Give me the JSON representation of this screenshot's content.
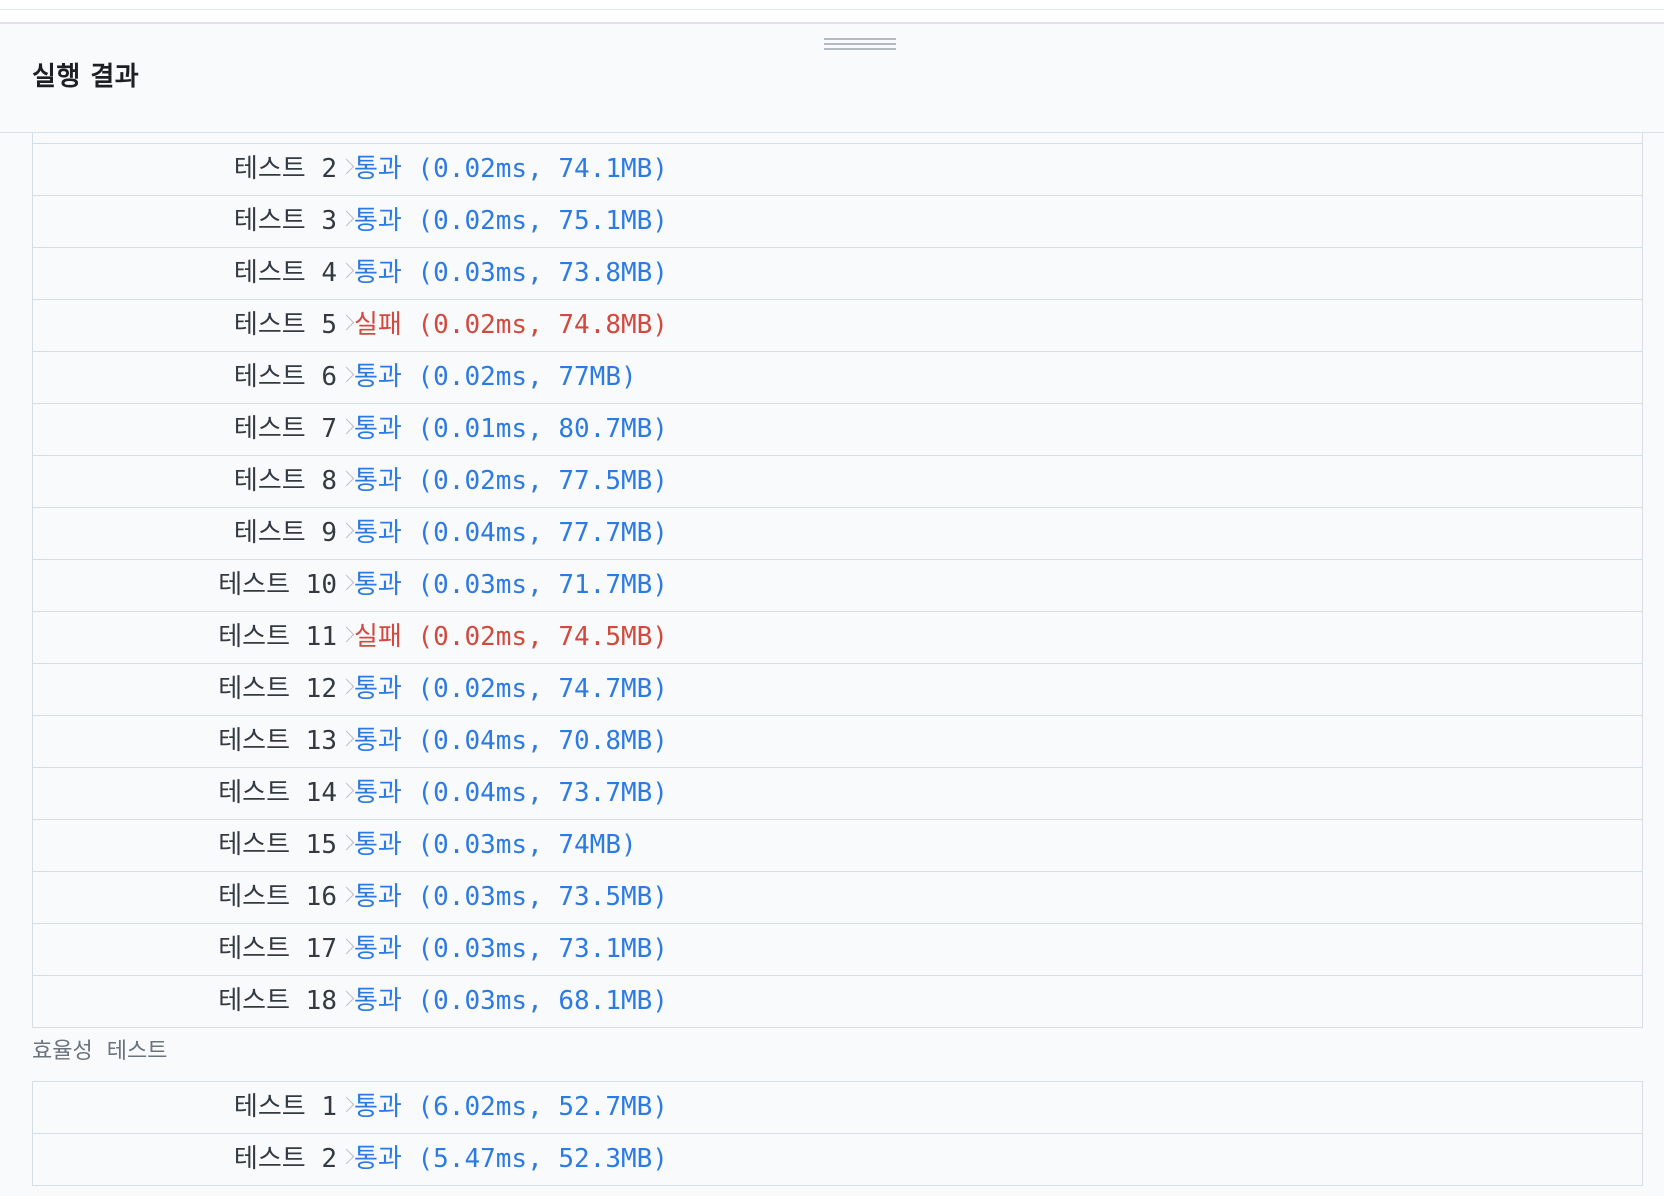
{
  "panel": {
    "title": "실행 결과"
  },
  "correctness_tests": [
    {
      "label": "테스트 2",
      "status": "통과",
      "detail": "(0.02ms, 74.1MB)",
      "passed": true
    },
    {
      "label": "테스트 3",
      "status": "통과",
      "detail": "(0.02ms, 75.1MB)",
      "passed": true
    },
    {
      "label": "테스트 4",
      "status": "통과",
      "detail": "(0.03ms, 73.8MB)",
      "passed": true
    },
    {
      "label": "테스트 5",
      "status": "실패",
      "detail": "(0.02ms, 74.8MB)",
      "passed": false
    },
    {
      "label": "테스트 6",
      "status": "통과",
      "detail": "(0.02ms, 77MB)",
      "passed": true
    },
    {
      "label": "테스트 7",
      "status": "통과",
      "detail": "(0.01ms, 80.7MB)",
      "passed": true
    },
    {
      "label": "테스트 8",
      "status": "통과",
      "detail": "(0.02ms, 77.5MB)",
      "passed": true
    },
    {
      "label": "테스트 9",
      "status": "통과",
      "detail": "(0.04ms, 77.7MB)",
      "passed": true
    },
    {
      "label": "테스트 10",
      "status": "통과",
      "detail": "(0.03ms, 71.7MB)",
      "passed": true
    },
    {
      "label": "테스트 11",
      "status": "실패",
      "detail": "(0.02ms, 74.5MB)",
      "passed": false
    },
    {
      "label": "테스트 12",
      "status": "통과",
      "detail": "(0.02ms, 74.7MB)",
      "passed": true
    },
    {
      "label": "테스트 13",
      "status": "통과",
      "detail": "(0.04ms, 70.8MB)",
      "passed": true
    },
    {
      "label": "테스트 14",
      "status": "통과",
      "detail": "(0.04ms, 73.7MB)",
      "passed": true
    },
    {
      "label": "테스트 15",
      "status": "통과",
      "detail": "(0.03ms, 74MB)",
      "passed": true
    },
    {
      "label": "테스트 16",
      "status": "통과",
      "detail": "(0.03ms, 73.5MB)",
      "passed": true
    },
    {
      "label": "테스트 17",
      "status": "통과",
      "detail": "(0.03ms, 73.1MB)",
      "passed": true
    },
    {
      "label": "테스트 18",
      "status": "통과",
      "detail": "(0.03ms, 68.1MB)",
      "passed": true
    }
  ],
  "efficiency_section": {
    "label": "효율성  테스트",
    "tests": [
      {
        "label": "테스트 1",
        "status": "통과",
        "detail": "(6.02ms, 52.7MB)",
        "passed": true
      },
      {
        "label": "테스트 2",
        "status": "통과",
        "detail": "(5.47ms, 52.3MB)",
        "passed": true
      }
    ]
  },
  "colors": {
    "pass": "#2c7be5",
    "fail": "#d4493f",
    "label": "#333a41",
    "border": "#d5dde6"
  }
}
